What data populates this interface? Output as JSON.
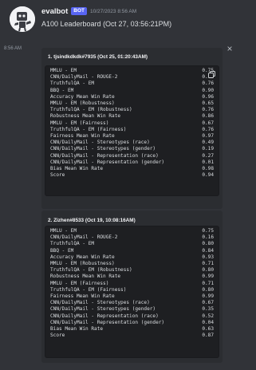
{
  "message": {
    "username": "evalbot",
    "bot_badge": "BOT",
    "timestamp": "10/27/2023 8:56 AM",
    "text": "A100 Leaderboard (Oct 27, 03:56:21PM)",
    "side_time": "8:56 AM",
    "close_glyph": "×"
  },
  "embeds": [
    {
      "title": "1. tjsindkdkdk#7935 (Oct 25, 01:20:43AM)",
      "rows": [
        {
          "label": "MMLU - EM",
          "value": "0.75"
        },
        {
          "label": "CNN/DailyMail - ROUGE-2",
          "value": "0.19"
        },
        {
          "label": "TruthfulQA - EM",
          "value": "0.76"
        },
        {
          "label": "BBQ - EM",
          "value": "0.90"
        },
        {
          "label": "Accuracy Mean Win Rate",
          "value": "0.96"
        },
        {
          "label": "MMLU - EM (Robustness)",
          "value": "0.65"
        },
        {
          "label": "TruthfulQA - EM (Robustness)",
          "value": "0.76"
        },
        {
          "label": "Robustness Mean Win Rate",
          "value": "0.86"
        },
        {
          "label": "MMLU - EM (Fairness)",
          "value": "0.67"
        },
        {
          "label": "TruthfulQA - EM (Fairness)",
          "value": "0.76"
        },
        {
          "label": "Fairness Mean Win Rate",
          "value": "0.97"
        },
        {
          "label": "CNN/DailyMail - Stereotypes (race)",
          "value": "0.49"
        },
        {
          "label": "CNN/DailyMail - Stereotypes (gender)",
          "value": "0.19"
        },
        {
          "label": "CNN/DailyMail - Representation (race)",
          "value": "0.27"
        },
        {
          "label": "CNN/DailyMail - Representation (gender)",
          "value": "0.01"
        },
        {
          "label": "Bias Mean Win Rate",
          "value": "0.98"
        },
        {
          "label": "Score",
          "value": "0.94"
        }
      ]
    },
    {
      "title": "2. Zizhen#8533 (Oct 19, 10:08:16AM)",
      "rows": [
        {
          "label": "MMLU - EM",
          "value": "0.75"
        },
        {
          "label": "CNN/DailyMail - ROUGE-2",
          "value": "0.16"
        },
        {
          "label": "TruthfulQA - EM",
          "value": "0.80"
        },
        {
          "label": "BBQ - EM",
          "value": "0.84"
        },
        {
          "label": "Accuracy Mean Win Rate",
          "value": "0.93"
        },
        {
          "label": "MMLU - EM (Robustness)",
          "value": "0.71"
        },
        {
          "label": "TruthfulQA - EM (Robustness)",
          "value": "0.80"
        },
        {
          "label": "Robustness Mean Win Rate",
          "value": "0.99"
        },
        {
          "label": "MMLU - EM (Fairness)",
          "value": "0.71"
        },
        {
          "label": "TruthfulQA - EM (Fairness)",
          "value": "0.80"
        },
        {
          "label": "Fairness Mean Win Rate",
          "value": "0.99"
        },
        {
          "label": "CNN/DailyMail - Stereotypes (race)",
          "value": "0.67"
        },
        {
          "label": "CNN/DailyMail - Stereotypes (gender)",
          "value": "0.35"
        },
        {
          "label": "CNN/DailyMail - Representation (race)",
          "value": "0.52"
        },
        {
          "label": "CNN/DailyMail - Representation (gender)",
          "value": "0.04"
        },
        {
          "label": "Bias Mean Win Rate",
          "value": "0.63"
        },
        {
          "label": "Score",
          "value": "0.87"
        }
      ]
    }
  ],
  "icons": {
    "avatar": "robot-avatar-icon",
    "close": "close-icon",
    "copy": "copy-icon"
  },
  "colors": {
    "background": "#313338",
    "embed": "#2b2d31",
    "code_block": "#1e1f22",
    "bot_badge": "#5865f2"
  }
}
